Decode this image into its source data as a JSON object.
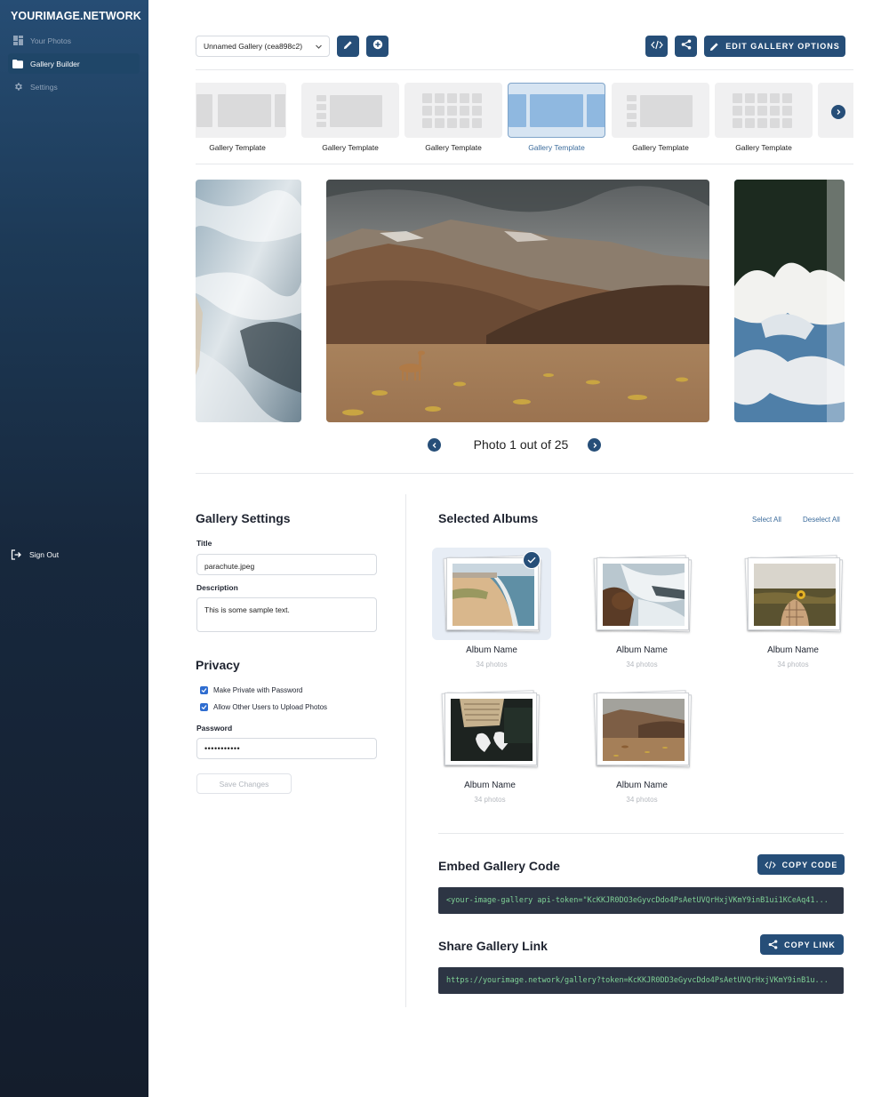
{
  "sidebar": {
    "brand": "YOURIMAGE.NETWORK",
    "items": [
      {
        "label": "Your Photos",
        "icon": "dashboard-icon"
      },
      {
        "label": "Gallery Builder",
        "icon": "folder-icon"
      },
      {
        "label": "Settings",
        "icon": "gear-icon"
      }
    ],
    "sign_out": "Sign Out"
  },
  "toolbar": {
    "gallery_select": "Unnamed Gallery (cea898c2)",
    "edit_options_label": "EDIT GALLERY OPTIONS"
  },
  "templates": [
    {
      "label": "Gallery Template",
      "selected": false
    },
    {
      "label": "Gallery Template",
      "selected": false
    },
    {
      "label": "Gallery Template",
      "selected": false
    },
    {
      "label": "Gallery Template",
      "selected": true
    },
    {
      "label": "Gallery Template",
      "selected": false
    },
    {
      "label": "Gallery Template",
      "selected": false
    }
  ],
  "carousel": {
    "status": "Photo 1 out of 25",
    "current": 1,
    "total": 25
  },
  "settings": {
    "heading": "Gallery Settings",
    "title_label": "Title",
    "title_value": "parachute.jpeg",
    "description_label": "Description",
    "description_value": "This is some sample text.",
    "privacy_heading": "Privacy",
    "private_label": "Make Private with Password",
    "private_checked": true,
    "uploads_label": "Allow Other Users to Upload Photos",
    "uploads_checked": true,
    "password_label": "Password",
    "password_value": "•••••••••••",
    "save_label": "Save Changes"
  },
  "albums": {
    "heading": "Selected Albums",
    "select_all": "Select All",
    "deselect_all": "Deselect All",
    "items": [
      {
        "name": "Album Name",
        "count": "34 photos",
        "selected": true
      },
      {
        "name": "Album Name",
        "count": "34 photos",
        "selected": false
      },
      {
        "name": "Album Name",
        "count": "34 photos",
        "selected": false
      },
      {
        "name": "Album Name",
        "count": "34 photos",
        "selected": false
      },
      {
        "name": "Album Name",
        "count": "34 photos",
        "selected": false
      }
    ]
  },
  "embed": {
    "heading": "Embed Gallery Code",
    "button": "COPY CODE",
    "code": "<your-image-gallery api-token=\"KcKKJR0DO3eGyvcDdo4PsAetUVQrHxjVKmY9inB1ui1KCeAq41..."
  },
  "share": {
    "heading": "Share Gallery Link",
    "button": "COPY LINK",
    "url": "https://yourimage.network/gallery?token=KcKKJR0DD3eGyvcDdo4PsAetUVQrHxjVKmY9inB1u..."
  },
  "colors": {
    "primary": "#264e78",
    "sidebar_top": "#264d74",
    "sidebar_bottom": "#141d2c",
    "code_bg": "#2d3544",
    "code_text": "#7fd296",
    "checkbox": "#2f6dd0"
  }
}
